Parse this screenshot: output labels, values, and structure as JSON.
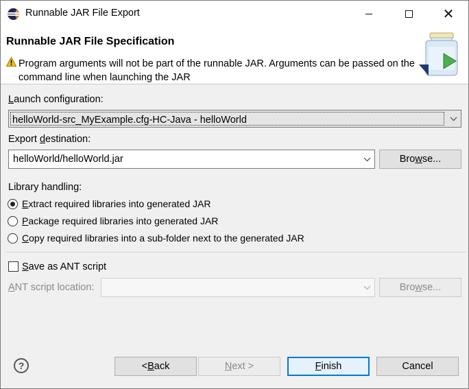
{
  "window": {
    "title": "Runnable JAR File Export",
    "app_icon": "eclipse-icon",
    "minimize_icon": "minimize-icon",
    "maximize_icon": "maximize-icon",
    "close_icon": "close-icon"
  },
  "banner": {
    "title": "Runnable JAR File Specification",
    "message": "Program arguments will not be part of the runnable JAR. Arguments can be passed on the command line when launching the JAR",
    "message_icon": "warning-icon",
    "art_icon": "jar-export-icon"
  },
  "launch": {
    "label_pre": "",
    "label_key": "L",
    "label_post": "aunch configuration:",
    "value": "helloWorld-src_MyExample.cfg-HC-Java - helloWorld"
  },
  "export": {
    "label_pre": "Export ",
    "label_key": "d",
    "label_post": "estination:",
    "value": "helloWorld/helloWorld.jar",
    "browse_pre": "Bro",
    "browse_key": "w",
    "browse_post": "se..."
  },
  "library": {
    "label": "Library handling:",
    "options": [
      {
        "pre": "",
        "key": "E",
        "post": "xtract required libraries into generated JAR",
        "selected": true
      },
      {
        "pre": "",
        "key": "P",
        "post": "ackage required libraries into generated JAR",
        "selected": false
      },
      {
        "pre": "",
        "key": "C",
        "post": "opy required libraries into a sub-folder next to the generated JAR",
        "selected": false
      }
    ]
  },
  "ant": {
    "checkbox_pre": "",
    "checkbox_key": "S",
    "checkbox_post": "ave as ANT script",
    "checked": false,
    "location_pre": "",
    "location_key": "A",
    "location_post": "NT script location:",
    "value": "",
    "browse_pre": "Bro",
    "browse_key": "w",
    "browse_post": "se..."
  },
  "footer": {
    "help_icon": "help-icon",
    "back_pre": "< ",
    "back_key": "B",
    "back_post": "ack",
    "next_pre": "",
    "next_key": "N",
    "next_post": "ext >",
    "finish_pre": "",
    "finish_key": "F",
    "finish_post": "inish",
    "cancel": "Cancel"
  },
  "colors": {
    "focus_accent": "#0078d7",
    "warning": "#f5c211"
  }
}
